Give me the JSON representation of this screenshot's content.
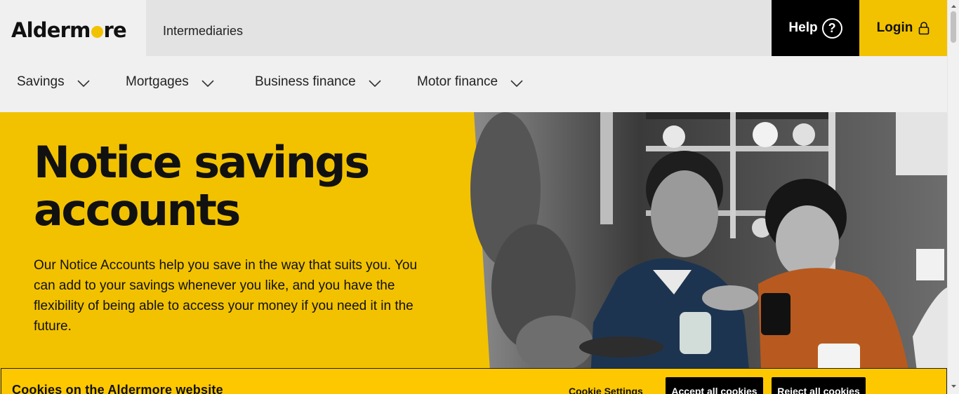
{
  "header": {
    "logo_text_start": "Alderm",
    "logo_text_end": "re",
    "intermediaries_label": "Intermediaries",
    "help_label": "Help",
    "login_label": "Login"
  },
  "nav": {
    "items": [
      {
        "label": "Savings"
      },
      {
        "label": "Mortgages"
      },
      {
        "label": "Business finance"
      },
      {
        "label": "Motor finance"
      }
    ]
  },
  "hero": {
    "title": "Notice savings accounts",
    "description": "Our Notice Accounts help you save in the way that suits you. You can add to your savings whenever you like, and you have the flexibility of being able to access your money if you need it in the future."
  },
  "cookie_banner": {
    "title": "Cookies on the Aldermore website",
    "settings_label": "Cookie Settings",
    "accept_label": "Accept all cookies",
    "reject_label": "Reject all cookies"
  },
  "colors": {
    "brand_yellow": "#f2c200",
    "black": "#000000",
    "light_grey": "#f0f0f0",
    "mid_grey": "#e3e3e3"
  },
  "icons": {
    "help": "question-circle-icon",
    "login": "padlock-icon",
    "nav_chevron": "chevron-down-icon"
  }
}
